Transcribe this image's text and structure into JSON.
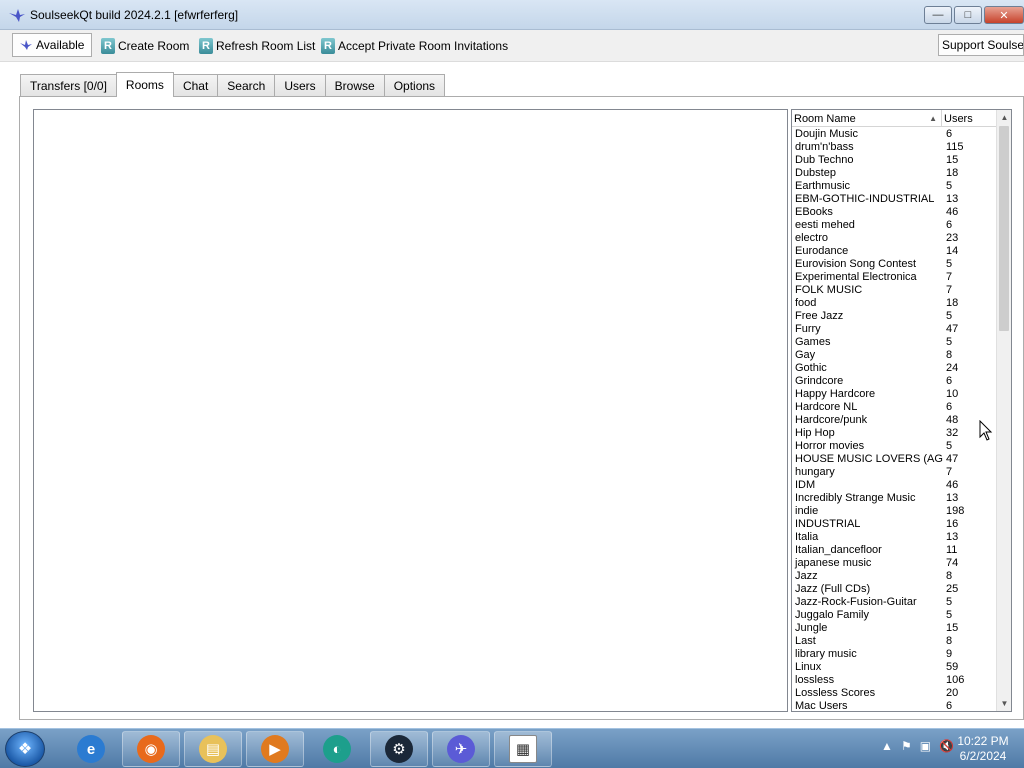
{
  "window": {
    "title": "SoulseekQt build 2024.2.1 [efwrferferg]",
    "minimize_symbol": "—",
    "maximize_symbol": "□",
    "close_symbol": "✕"
  },
  "toolbar": {
    "status_label": "Available",
    "create_room_label": "Create Room",
    "refresh_room_list_label": "Refresh Room List",
    "accept_invitations_label": "Accept Private Room Invitations",
    "support_label": "Support Soulseek",
    "room_icon_letter": "R"
  },
  "tabs": [
    {
      "label": "Transfers [0/0]"
    },
    {
      "label": "Rooms"
    },
    {
      "label": "Chat"
    },
    {
      "label": "Search"
    },
    {
      "label": "Users"
    },
    {
      "label": "Browse"
    },
    {
      "label": "Options"
    }
  ],
  "active_tab": "Rooms",
  "room_table": {
    "col_name": "Room Name",
    "col_users": "Users",
    "sort_indicator": "▲",
    "rows": [
      {
        "name": "Doujin Music",
        "users": "6"
      },
      {
        "name": "drum'n'bass",
        "users": "115"
      },
      {
        "name": "Dub Techno",
        "users": "15"
      },
      {
        "name": "Dubstep",
        "users": "18"
      },
      {
        "name": "Earthmusic",
        "users": "5"
      },
      {
        "name": "EBM-GOTHIC-INDUSTRIAL",
        "users": "13"
      },
      {
        "name": "EBooks",
        "users": "46"
      },
      {
        "name": "eesti mehed",
        "users": "6"
      },
      {
        "name": "electro",
        "users": "23"
      },
      {
        "name": "Eurodance",
        "users": "14"
      },
      {
        "name": "Eurovision Song Contest",
        "users": "5"
      },
      {
        "name": "Experimental Electronica",
        "users": "7"
      },
      {
        "name": "FOLK MUSIC",
        "users": "7"
      },
      {
        "name": "food",
        "users": "18"
      },
      {
        "name": "Free Jazz",
        "users": "5"
      },
      {
        "name": "Furry",
        "users": "47"
      },
      {
        "name": "Games",
        "users": "5"
      },
      {
        "name": "Gay",
        "users": "8"
      },
      {
        "name": "Gothic",
        "users": "24"
      },
      {
        "name": "Grindcore",
        "users": "6"
      },
      {
        "name": "Happy Hardcore",
        "users": "10"
      },
      {
        "name": "Hardcore NL",
        "users": "6"
      },
      {
        "name": "Hardcore/punk",
        "users": "48"
      },
      {
        "name": "Hip Hop",
        "users": "32"
      },
      {
        "name": "Horror movies",
        "users": "5"
      },
      {
        "name": "HOUSE MUSIC LOVERS (AG)",
        "users": "47"
      },
      {
        "name": "hungary",
        "users": "7"
      },
      {
        "name": "IDM",
        "users": "46"
      },
      {
        "name": "Incredibly Strange Music",
        "users": "13"
      },
      {
        "name": "indie",
        "users": "198"
      },
      {
        "name": "INDUSTRIAL",
        "users": "16"
      },
      {
        "name": "Italia",
        "users": "13"
      },
      {
        "name": "Italian_dancefloor",
        "users": "11"
      },
      {
        "name": "japanese music",
        "users": "74"
      },
      {
        "name": "Jazz",
        "users": "8"
      },
      {
        "name": "Jazz (Full CDs)",
        "users": "25"
      },
      {
        "name": "Jazz-Rock-Fusion-Guitar",
        "users": "5"
      },
      {
        "name": "Juggalo Family",
        "users": "5"
      },
      {
        "name": "Jungle",
        "users": "15"
      },
      {
        "name": "Last",
        "users": "8"
      },
      {
        "name": "library music",
        "users": "9"
      },
      {
        "name": "Linux",
        "users": "59"
      },
      {
        "name": "lossless",
        "users": "106"
      },
      {
        "name": "Lossless Scores",
        "users": "20"
      },
      {
        "name": "Mac Users",
        "users": "6"
      }
    ]
  },
  "taskbar": {
    "start_symbol": "❖",
    "apps": [
      {
        "name": "internet-explorer",
        "glyph": "e",
        "color": "#2b7bd1"
      },
      {
        "name": "firefox",
        "glyph": "◉",
        "color": "#e86a1c"
      },
      {
        "name": "file-explorer",
        "glyph": "▤",
        "color": "#e8c15a"
      },
      {
        "name": "media-player",
        "glyph": "▶",
        "color": "#e07a1f"
      },
      {
        "name": "app-teal",
        "glyph": "◐",
        "color": "#1d9f8c"
      },
      {
        "name": "steam",
        "glyph": "⚙",
        "color": "#1b2838"
      },
      {
        "name": "soulseek",
        "glyph": "✈",
        "color": "#5b5bd6"
      },
      {
        "name": "document-viewer",
        "glyph": "▦",
        "color": "#ffffff"
      }
    ],
    "tray": {
      "chevron": "▲",
      "flag_icon": "⚑",
      "network_icon": "▣",
      "volume_icon": "🔇"
    },
    "clock_time": "10:22 PM",
    "clock_date": "6/2/2024"
  }
}
